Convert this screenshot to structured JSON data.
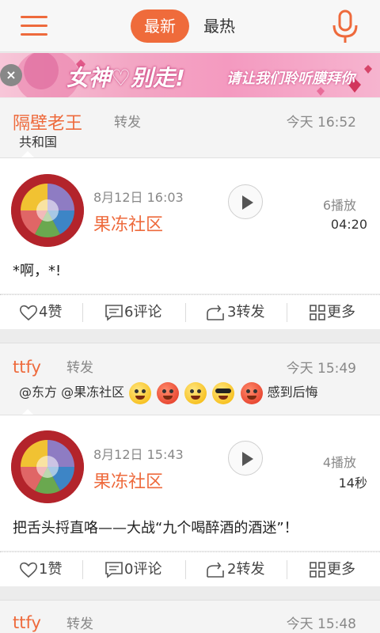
{
  "header": {
    "tabs": [
      {
        "label": "最新",
        "active": true
      },
      {
        "label": "最热",
        "active": false
      }
    ],
    "icons": {
      "menu": "hamburger-menu-icon",
      "mic": "microphone-icon"
    },
    "accent_color": "#ef6b3b"
  },
  "banner": {
    "close": "×",
    "title": "女神♡别走!",
    "subtitle": "请让我们聆听膜拜你"
  },
  "posts": [
    {
      "username": "隔壁老王",
      "repost_tag": "转发",
      "time": "今天 16:52",
      "repost_text": "共和国",
      "card": {
        "date": "8月12日 16:03",
        "community": "果冻社区",
        "plays": "6播放",
        "duration": "04:20",
        "content": "*啊，*!"
      },
      "actions": {
        "like": "4赞",
        "comment": "6评论",
        "share": "3转发",
        "more": "更多"
      }
    },
    {
      "username": "ttfy",
      "repost_tag": "转发",
      "time": "今天 15:49",
      "repost_text": "@东方 @果冻社区",
      "repost_suffix": "感到后悔",
      "card": {
        "date": "8月12日 15:43",
        "community": "果冻社区",
        "plays": "4播放",
        "duration": "14秒",
        "content": "把舌头捋直咯——大战“九个喝醉酒的酒迷”！"
      },
      "actions": {
        "like": "1赞",
        "comment": "0评论",
        "share": "2转发",
        "more": "更多"
      }
    },
    {
      "username": "ttfy",
      "repost_tag": "转发",
      "time": "今天 15:48"
    }
  ]
}
